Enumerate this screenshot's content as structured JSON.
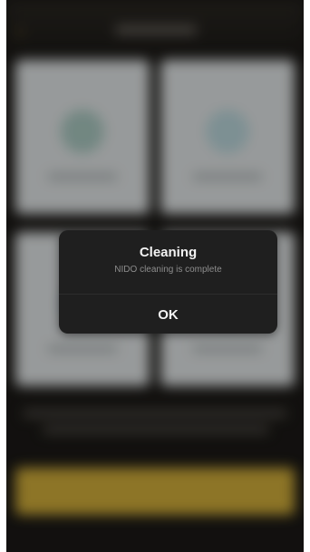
{
  "dialog": {
    "title": "Cleaning",
    "message": "NIDO cleaning is complete",
    "ok_label": "OK"
  },
  "background": {
    "accent_color": "#d9b43c",
    "icons": {
      "back": "back-arrow-icon"
    }
  }
}
